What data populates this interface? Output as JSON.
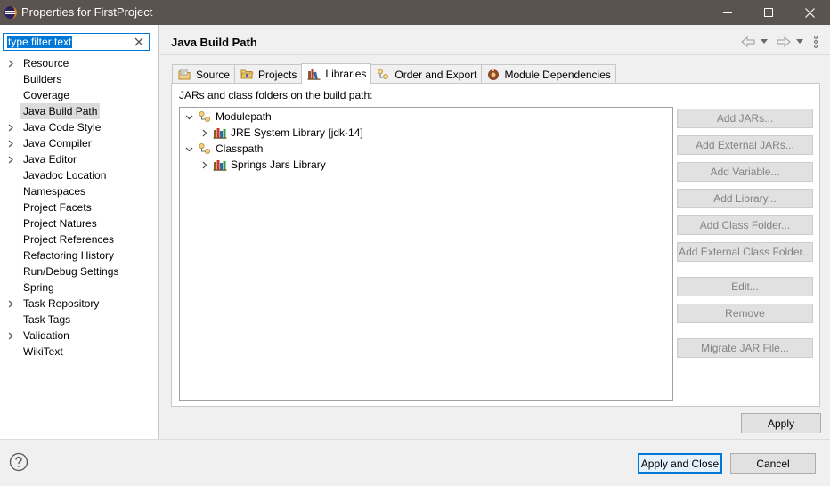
{
  "window": {
    "title": "Properties for FirstProject",
    "controls": [
      "minimize",
      "maximize",
      "close"
    ]
  },
  "filter": {
    "value": "type filter text"
  },
  "nav": {
    "items": [
      {
        "label": "Resource",
        "expandable": true
      },
      {
        "label": "Builders",
        "expandable": false
      },
      {
        "label": "Coverage",
        "expandable": false
      },
      {
        "label": "Java Build Path",
        "expandable": false,
        "selected": true
      },
      {
        "label": "Java Code Style",
        "expandable": true
      },
      {
        "label": "Java Compiler",
        "expandable": true
      },
      {
        "label": "Java Editor",
        "expandable": true
      },
      {
        "label": "Javadoc Location",
        "expandable": false
      },
      {
        "label": "Namespaces",
        "expandable": false
      },
      {
        "label": "Project Facets",
        "expandable": false
      },
      {
        "label": "Project Natures",
        "expandable": false
      },
      {
        "label": "Project References",
        "expandable": false
      },
      {
        "label": "Refactoring History",
        "expandable": false
      },
      {
        "label": "Run/Debug Settings",
        "expandable": false
      },
      {
        "label": "Spring",
        "expandable": false
      },
      {
        "label": "Task Repository",
        "expandable": true
      },
      {
        "label": "Task Tags",
        "expandable": false
      },
      {
        "label": "Validation",
        "expandable": true
      },
      {
        "label": "WikiText",
        "expandable": false
      }
    ]
  },
  "page": {
    "title": "Java Build Path"
  },
  "tabs": [
    {
      "label": "Source",
      "icon": "source-folder-icon"
    },
    {
      "label": "Projects",
      "icon": "projects-folder-icon"
    },
    {
      "label": "Libraries",
      "icon": "libraries-icon",
      "active": true
    },
    {
      "label": "Order and Export",
      "icon": "order-export-icon"
    },
    {
      "label": "Module Dependencies",
      "icon": "module-dependencies-icon"
    }
  ],
  "libraries": {
    "caption": "JARs and class folders on the build path:",
    "tree": [
      {
        "label": "Modulepath",
        "expanded": true,
        "children": [
          {
            "label": "JRE System Library [jdk-14]"
          }
        ]
      },
      {
        "label": "Classpath",
        "expanded": true,
        "children": [
          {
            "label": "Springs Jars Library"
          }
        ]
      }
    ],
    "buttons": {
      "add_jars": "Add JARs...",
      "add_external_jars": "Add External JARs...",
      "add_variable": "Add Variable...",
      "add_library": "Add Library...",
      "add_class_folder": "Add Class Folder...",
      "add_external_class_folder": "Add External Class Folder...",
      "edit": "Edit...",
      "remove": "Remove",
      "migrate_jar": "Migrate JAR File..."
    }
  },
  "actions": {
    "apply": "Apply",
    "apply_and_close": "Apply and Close",
    "cancel": "Cancel"
  },
  "colors": {
    "titlebar": "#5a5350",
    "focus_blue": "#0078d7",
    "disabled_text": "#838383"
  }
}
